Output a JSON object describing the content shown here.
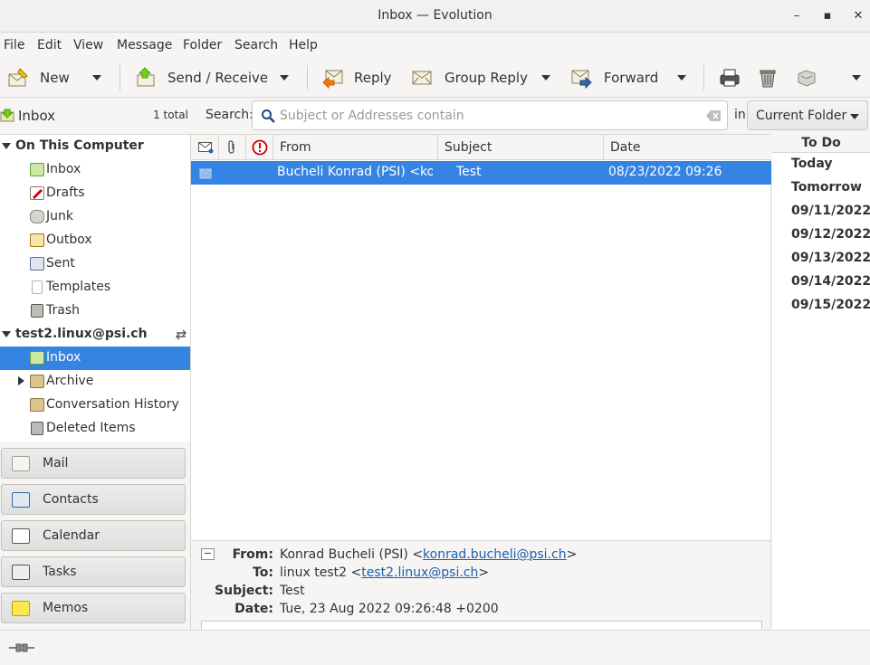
{
  "window": {
    "title": "Inbox — Evolution",
    "minimize": "–",
    "maximize": "▪",
    "close": "✕"
  },
  "menu": [
    "File",
    "Edit",
    "View",
    "Message",
    "Folder",
    "Search",
    "Help"
  ],
  "toolbar": {
    "new_label": "New",
    "send_receive_label": "Send / Receive",
    "reply_label": "Reply",
    "group_reply_label": "Group Reply",
    "forward_label": "Forward"
  },
  "sidebar": {
    "header": {
      "label": "Inbox",
      "count": "1 total"
    },
    "local_group": "On This Computer",
    "local_folders": [
      "Inbox",
      "Drafts",
      "Junk",
      "Outbox",
      "Sent",
      "Templates",
      "Trash"
    ],
    "account": "test2.linux@psi.ch",
    "account_folders": [
      "Inbox",
      "Archive",
      "Conversation History",
      "Deleted Items"
    ],
    "selected": "Inbox (test2.linux@psi.ch)"
  },
  "switcher": [
    "Mail",
    "Contacts",
    "Calendar",
    "Tasks",
    "Memos"
  ],
  "search": {
    "label": "Search:",
    "placeholder": "Subject or Addresses contain",
    "in_label": "in",
    "scope": "Current Folder"
  },
  "message_list": {
    "columns": [
      "From",
      "Subject",
      "Date"
    ],
    "rows": [
      {
        "from": "Bucheli Konrad (PSI) <ko...",
        "subject": "Test",
        "date": "08/23/2022 09:26"
      }
    ]
  },
  "preview": {
    "from_key": "From:",
    "from_name": "Konrad Bucheli (PSI) <",
    "from_email": "konrad.bucheli@psi.ch",
    "from_close": ">",
    "to_key": "To:",
    "to_name": "linux test2 <",
    "to_email": "test2.linux@psi.ch",
    "to_close": ">",
    "subject_key": "Subject:",
    "subject": "Test",
    "date_key": "Date:",
    "date": "Tue, 23 Aug 2022 09:26:48 +0200"
  },
  "todo": {
    "title": "To Do",
    "days": [
      "Today",
      "Tomorrow",
      "09/11/2022",
      "09/12/2022",
      "09/13/2022",
      "09/14/2022",
      "09/15/2022"
    ]
  },
  "colors": {
    "selection": "#3584e4",
    "link": "#1c5fb0",
    "important": "#cc0000"
  }
}
